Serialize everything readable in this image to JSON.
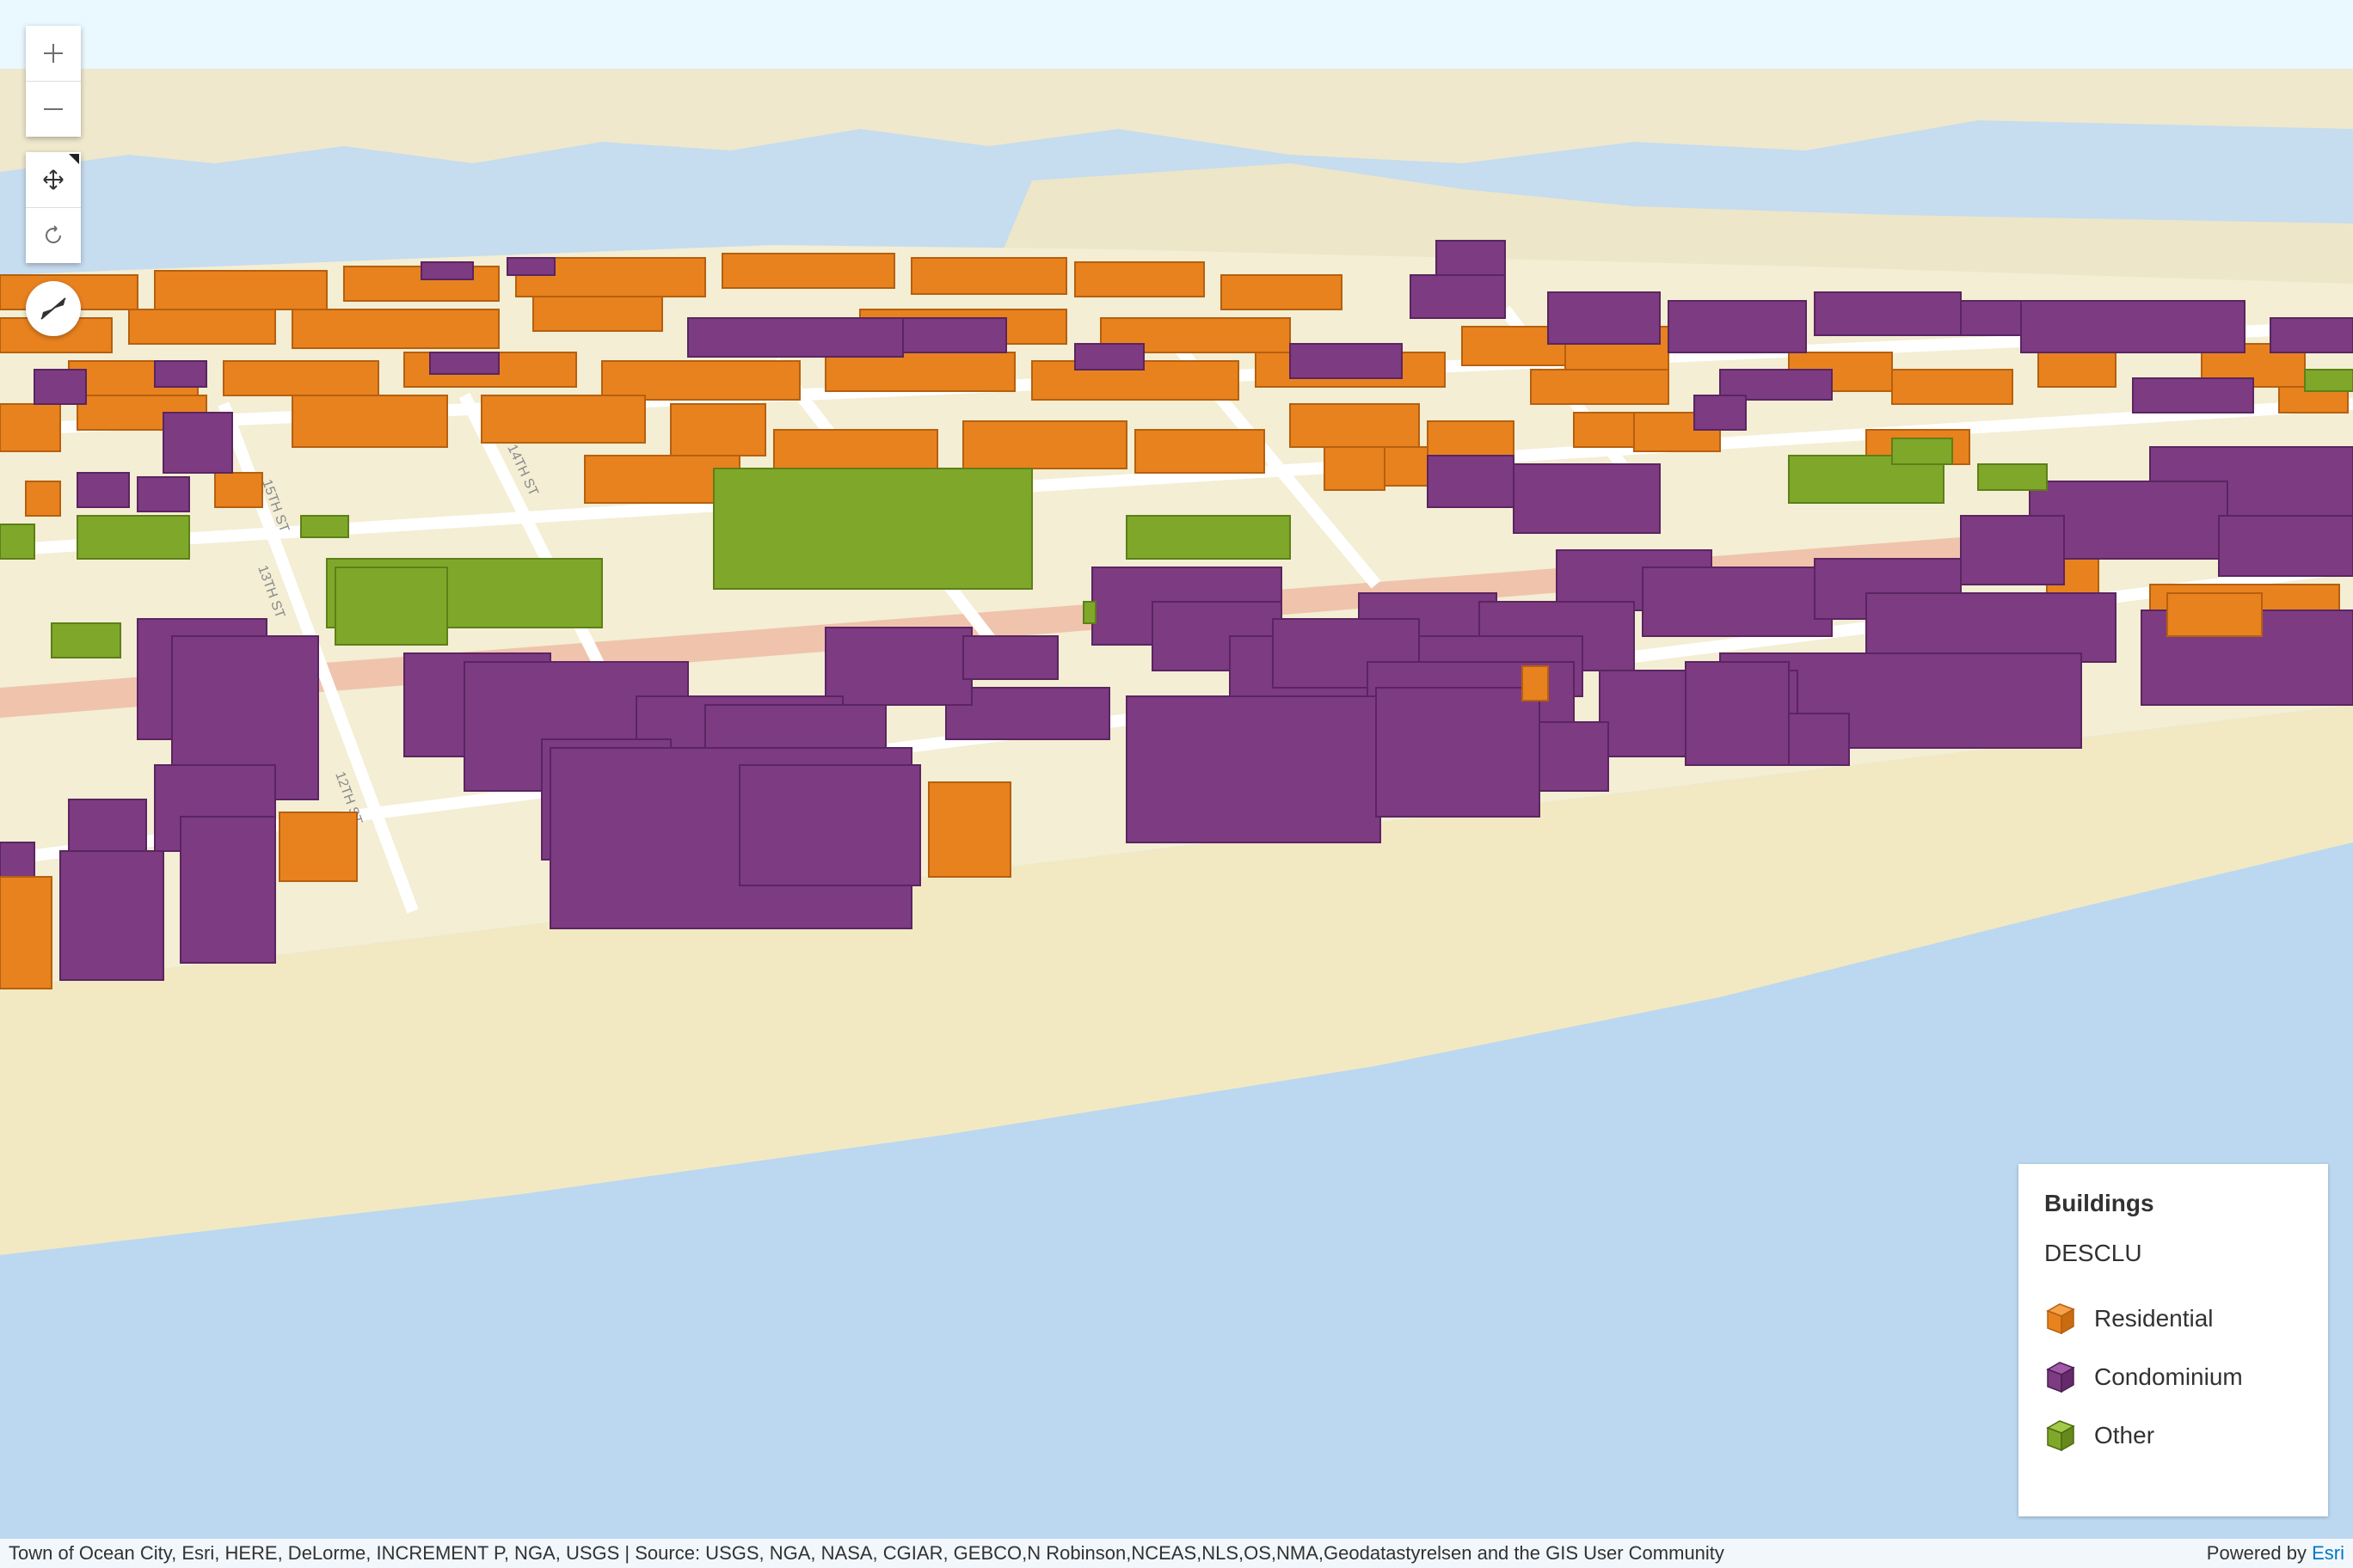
{
  "map": {
    "colors": {
      "sky": "#eaf8ff",
      "water": "#bcd8f0",
      "land": "#f5efcf",
      "beach": "#f2e8c2",
      "street": "#ffffff",
      "highway": "#f0c0a8",
      "residential": "#e8821e",
      "condominium": "#7d3b82",
      "other": "#7fa82a"
    },
    "street_labels": [
      "15TH ST",
      "14TH ST",
      "13TH ST",
      "12TH ST"
    ]
  },
  "controls": {
    "zoom_in_icon": "plus-icon",
    "zoom_out_icon": "minus-icon",
    "pan_icon": "move-icon",
    "rotate_icon": "rotate-icon",
    "compass_icon": "compass-icon"
  },
  "legend": {
    "layer_title": "Buildings",
    "field": "DESCLU",
    "items": [
      {
        "label": "Residential",
        "color": "#e8821e"
      },
      {
        "label": "Condominium",
        "color": "#7d3b82"
      },
      {
        "label": "Other",
        "color": "#7fa82a"
      }
    ]
  },
  "attribution": {
    "sources": "Town of Ocean City, Esri, HERE, DeLorme, INCREMENT P, NGA, USGS | Source: USGS, NGA, NASA, CGIAR, GEBCO,N Robinson,NCEAS,NLS,OS,NMA,Geodatastyrelsen and the GIS User Community",
    "powered_by": "Powered by",
    "esri": "Esri"
  }
}
